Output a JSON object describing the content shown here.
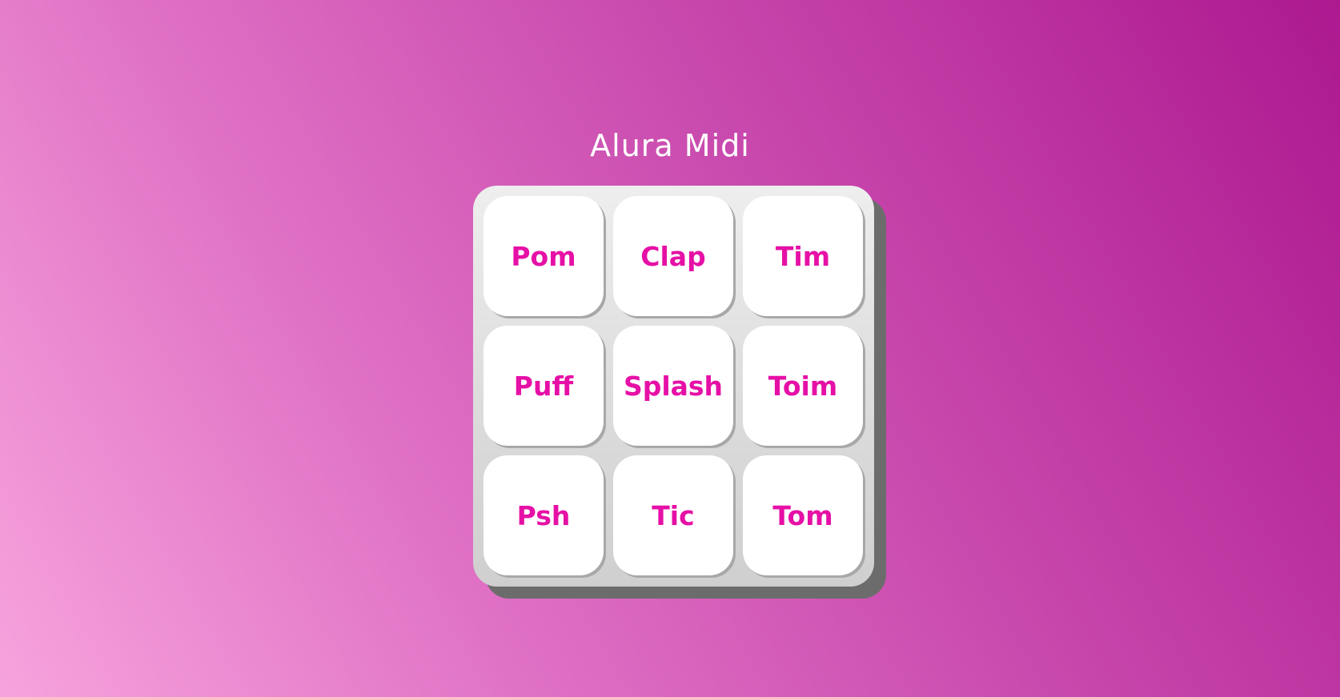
{
  "app": {
    "title": "Alura Midi"
  },
  "colors": {
    "key_text": "#e610a6",
    "key_background": "#ffffff",
    "title_text": "#ffffff"
  },
  "keys": [
    {
      "label": "Pom"
    },
    {
      "label": "Clap"
    },
    {
      "label": "Tim"
    },
    {
      "label": "Puff"
    },
    {
      "label": "Splash"
    },
    {
      "label": "Toim"
    },
    {
      "label": "Psh"
    },
    {
      "label": "Tic"
    },
    {
      "label": "Tom"
    }
  ]
}
